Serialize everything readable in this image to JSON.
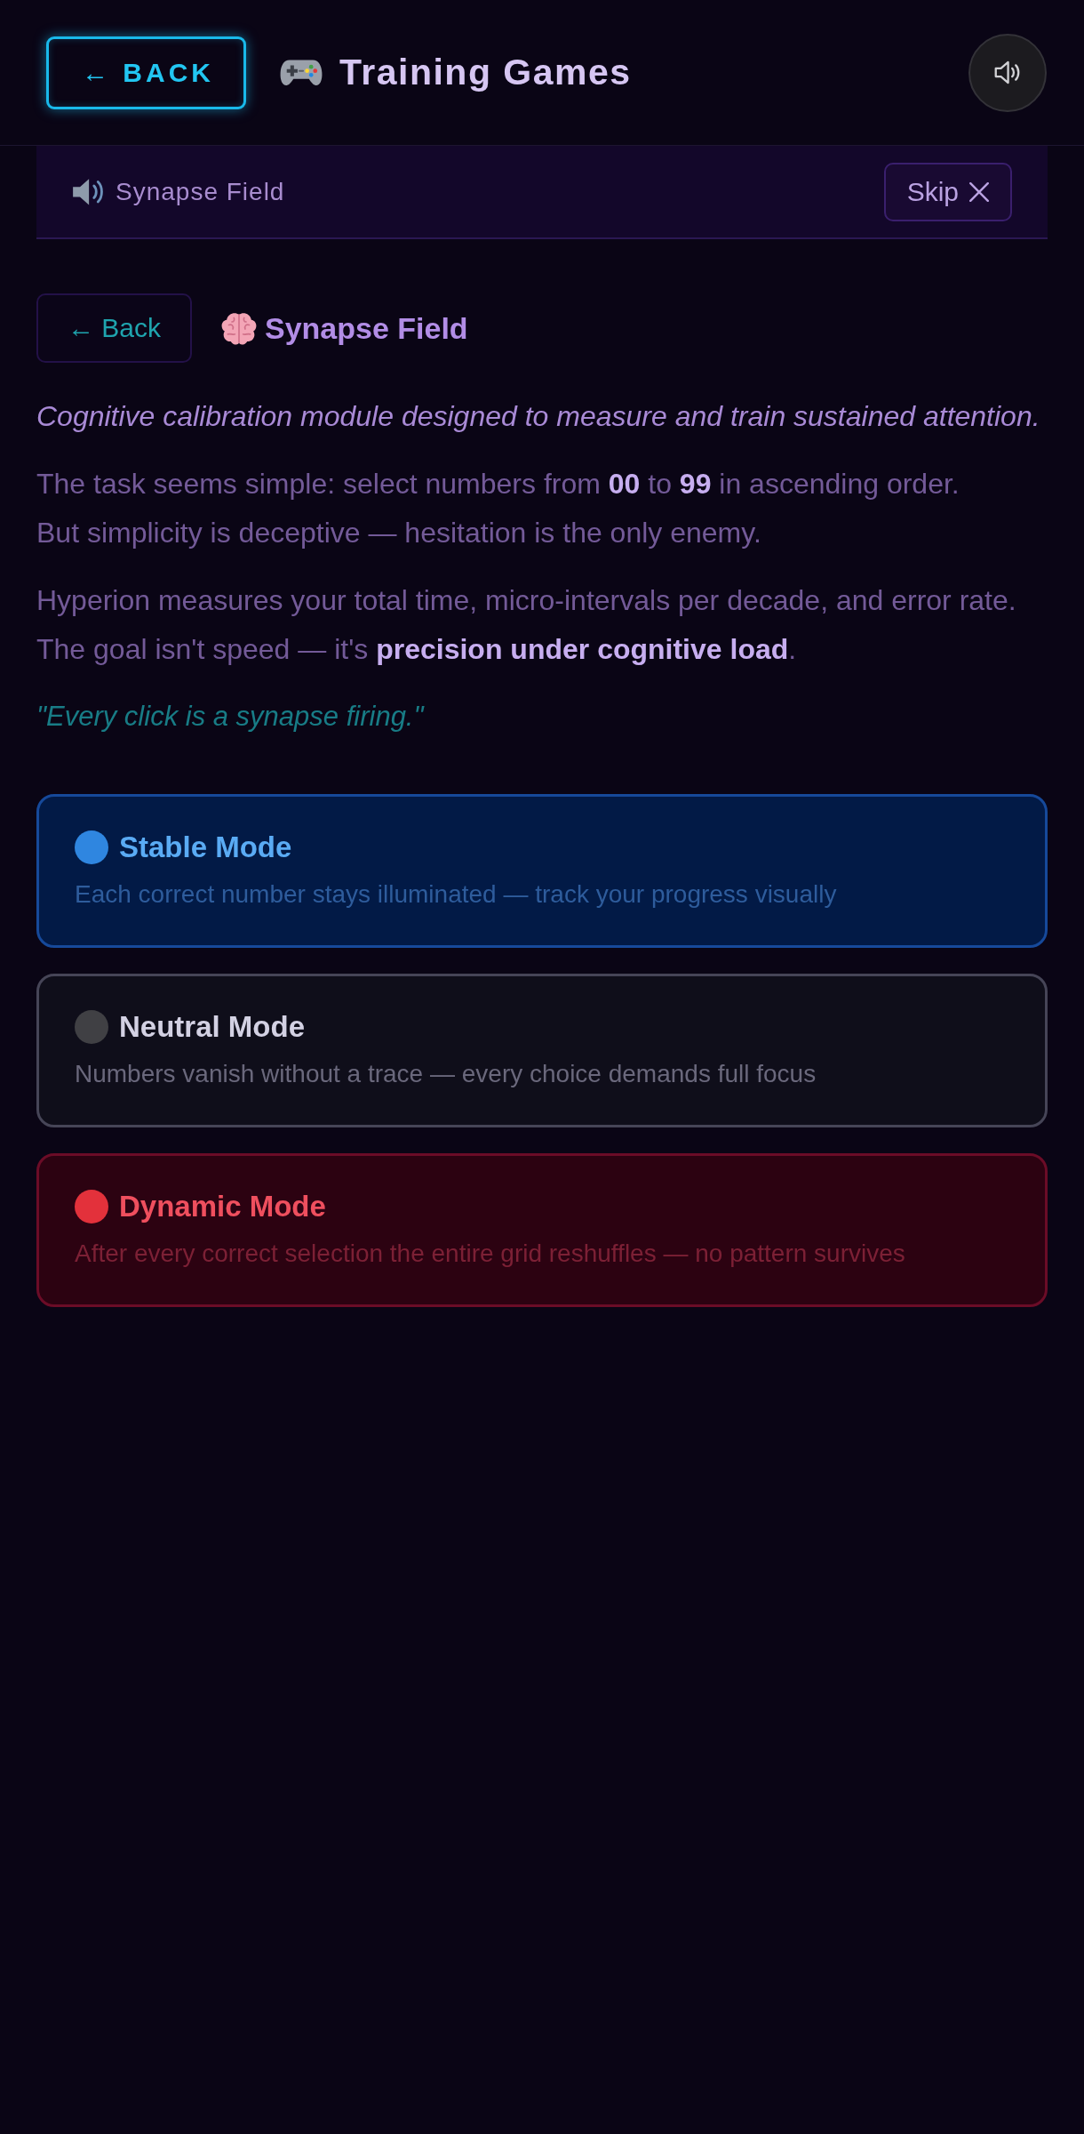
{
  "header": {
    "back_button": "← BACK",
    "title": "Training Games"
  },
  "banner": {
    "title": "Synapse Field",
    "skip_button": "Skip"
  },
  "game": {
    "back_button": "← Back",
    "title": "Synapse Field",
    "tagline": "Cognitive calibration module designed to measure and train sustained attention.",
    "paragraphs": [
      "The task seems simple: select numbers from **00** to **99** in ascending order.\nBut simplicity is deceptive — hesitation is the only enemy.",
      "Hyperion measures your total time, micro-intervals per decade, and error rate.\nThe goal isn't speed — it's **precision under cognitive load**."
    ],
    "quote": "\"Every click is a synapse firing.\""
  },
  "modes": [
    {
      "kind": "stable",
      "color": "#2f86e0",
      "title": "Stable Mode",
      "description": "Each correct number stays illuminated — track your progress visually"
    },
    {
      "kind": "neutral",
      "color": "#404044",
      "title": "Neutral Mode",
      "description": "Numbers vanish without a trace — every choice demands full focus"
    },
    {
      "kind": "dynamic",
      "color": "#e3313b",
      "title": "Dynamic Mode",
      "description": "After every correct selection the entire grid reshuffles — no pattern survives"
    }
  ]
}
